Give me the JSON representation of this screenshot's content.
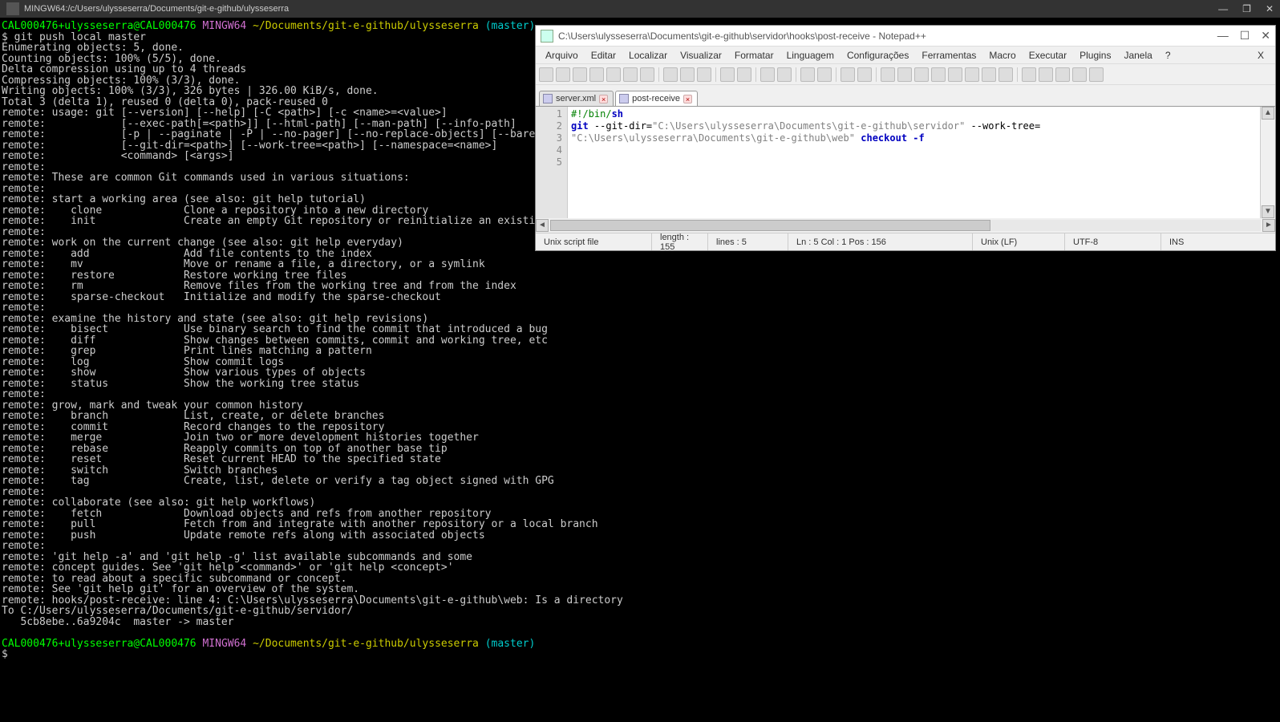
{
  "terminal": {
    "title": "MINGW64:/c/Users/ulysseserra/Documents/git-e-github/ulysseserra",
    "prompt_user": "CAL000476+ulysseserra@CAL000476",
    "prompt_shell": "MINGW64",
    "prompt_path": "~/Documents/git-e-github/ulysseserra",
    "prompt_branch": "(master)",
    "command1": "$ git push local master",
    "lines": [
      "Enumerating objects: 5, done.",
      "Counting objects: 100% (5/5), done.",
      "Delta compression using up to 4 threads",
      "Compressing objects: 100% (3/3), done.",
      "Writing objects: 100% (3/3), 326 bytes | 326.00 KiB/s, done.",
      "Total 3 (delta 1), reused 0 (delta 0), pack-reused 0",
      "remote: usage: git [--version] [--help] [-C <path>] [-c <name>=<value>]",
      "remote:            [--exec-path[=<path>]] [--html-path] [--man-path] [--info-path]",
      "remote:            [-p | --paginate | -P | --no-pager] [--no-replace-objects] [--bare]",
      "remote:            [--git-dir=<path>] [--work-tree=<path>] [--namespace=<name>]",
      "remote:            <command> [<args>]",
      "remote:",
      "remote: These are common Git commands used in various situations:",
      "remote:",
      "remote: start a working area (see also: git help tutorial)",
      "remote:    clone             Clone a repository into a new directory",
      "remote:    init              Create an empty Git repository or reinitialize an existing one",
      "remote:",
      "remote: work on the current change (see also: git help everyday)",
      "remote:    add               Add file contents to the index",
      "remote:    mv                Move or rename a file, a directory, or a symlink",
      "remote:    restore           Restore working tree files",
      "remote:    rm                Remove files from the working tree and from the index",
      "remote:    sparse-checkout   Initialize and modify the sparse-checkout",
      "remote:",
      "remote: examine the history and state (see also: git help revisions)",
      "remote:    bisect            Use binary search to find the commit that introduced a bug",
      "remote:    diff              Show changes between commits, commit and working tree, etc",
      "remote:    grep              Print lines matching a pattern",
      "remote:    log               Show commit logs",
      "remote:    show              Show various types of objects",
      "remote:    status            Show the working tree status",
      "remote:",
      "remote: grow, mark and tweak your common history",
      "remote:    branch            List, create, or delete branches",
      "remote:    commit            Record changes to the repository",
      "remote:    merge             Join two or more development histories together",
      "remote:    rebase            Reapply commits on top of another base tip",
      "remote:    reset             Reset current HEAD to the specified state",
      "remote:    switch            Switch branches",
      "remote:    tag               Create, list, delete or verify a tag object signed with GPG",
      "remote:",
      "remote: collaborate (see also: git help workflows)",
      "remote:    fetch             Download objects and refs from another repository",
      "remote:    pull              Fetch from and integrate with another repository or a local branch",
      "remote:    push              Update remote refs along with associated objects",
      "remote:",
      "remote: 'git help -a' and 'git help -g' list available subcommands and some",
      "remote: concept guides. See 'git help <command>' or 'git help <concept>'",
      "remote: to read about a specific subcommand or concept.",
      "remote: See 'git help git' for an overview of the system.",
      "remote: hooks/post-receive: line 4: C:\\Users\\ulysseserra\\Documents\\git-e-github\\web: Is a directory",
      "To C:/Users/ulysseserra/Documents/git-e-github/servidor/",
      "   5cb8ebe..6a9204c  master -> master"
    ],
    "cursor": "$ "
  },
  "notepad": {
    "title": "C:\\Users\\ulysseserra\\Documents\\git-e-github\\servidor\\hooks\\post-receive - Notepad++",
    "menus": [
      "Arquivo",
      "Editar",
      "Localizar",
      "Visualizar",
      "Formatar",
      "Linguagem",
      "Configurações",
      "Ferramentas",
      "Macro",
      "Executar",
      "Plugins",
      "Janela",
      "?"
    ],
    "tabs": [
      {
        "label": "server.xml",
        "active": false
      },
      {
        "label": "post-receive",
        "active": true
      }
    ],
    "gutter": [
      "1",
      "2",
      "3",
      "4",
      "5"
    ],
    "code": {
      "l1_shebang": "#!/bin/",
      "l1_sh": "sh",
      "l2": "",
      "l3_cmd": "git",
      "l3_opt1": " --git-dir=",
      "l3_str1": "\"C:\\Users\\ulysseserra\\Documents\\git-e-github\\servidor\"",
      "l3_opt2": " --work-tree=",
      "l4_str": "\"C:\\Users\\ulysseserra\\Documents\\git-e-github\\web\"",
      "l4_cmd": " checkout -f",
      "l5": ""
    },
    "status": {
      "filetype": "Unix script file",
      "length": "length : 155",
      "lines": "lines : 5",
      "pos": "Ln : 5   Col : 1   Pos : 156",
      "eol": "Unix (LF)",
      "encoding": "UTF-8",
      "mode": "INS"
    }
  }
}
